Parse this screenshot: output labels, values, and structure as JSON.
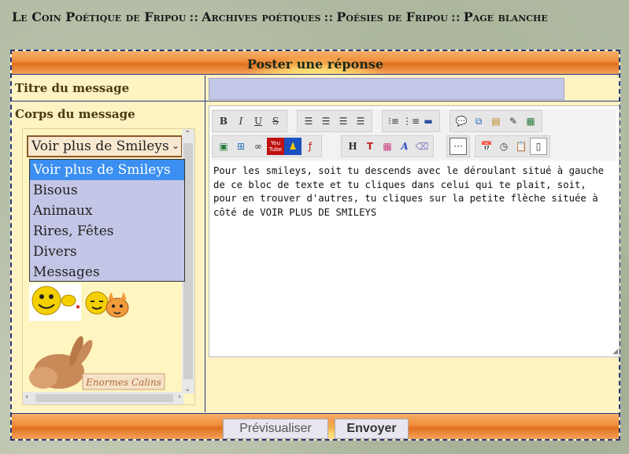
{
  "breadcrumb": [
    "Le Coin Poétique de Fripou",
    "Archives poétiques",
    "Poésies de Fripou",
    "Page blanche"
  ],
  "breadcrumb_separator": "::",
  "form": {
    "header": "Poster une réponse",
    "title_label": "Titre du message",
    "title_value": "",
    "body_label": "Corps du message",
    "body_text": "Pour les smileys, soit tu descends avec le déroulant situé à gauche de ce bloc de texte et tu cliques dans celui qui te plait, soit, pour en trouver d'autres, tu cliques sur la petite flèche située à côté de VOIR PLUS DE SMILEYS"
  },
  "smileys": {
    "select_value": "Voir plus de Smileys",
    "options": [
      "Voir plus de Smileys",
      "Bisous",
      "Animaux",
      "Rires, Fêtes",
      "Divers",
      "Messages"
    ],
    "selected_index": 0,
    "image_caption": "Enormes Calins"
  },
  "toolbar": {
    "row1": [
      [
        "bold-icon",
        "italic-icon",
        "underline-icon",
        "strikethrough-icon"
      ],
      [
        "align-left-icon",
        "align-center-icon",
        "align-right-icon",
        "align-justify-icon"
      ],
      [
        "bullet-list-icon",
        "numbered-list-icon",
        "horizontal-rule-icon"
      ],
      [
        "quote-icon",
        "code-icon",
        "spoiler-icon",
        "edit-icon",
        "table-icon"
      ]
    ],
    "row2": [
      [
        "image-icon",
        "image-upload-icon",
        "link-icon",
        "youtube-icon",
        "dailymotion-icon",
        "flash-icon"
      ],
      [
        "heading-icon",
        "text-color-icon",
        "color-grid-icon",
        "font-icon",
        "clear-format-icon"
      ],
      [
        "more-icon"
      ],
      [
        "date-icon",
        "time-icon",
        "paste-icon",
        "source-icon"
      ]
    ],
    "youtube_label": "You Tube",
    "heading_label": "H",
    "bold_label": "B",
    "italic_label": "I",
    "underline_label": "U",
    "strike_label": "S",
    "font_label": "A",
    "more_label": "···"
  },
  "buttons": {
    "preview": "Prévisualiser",
    "send": "Envoyer"
  },
  "colors": {
    "accent_orange": "#f08d3a",
    "panel_yellow": "#fff2c3",
    "input_lavender": "#c3c8e8",
    "selected_blue": "#3b8ff0"
  }
}
